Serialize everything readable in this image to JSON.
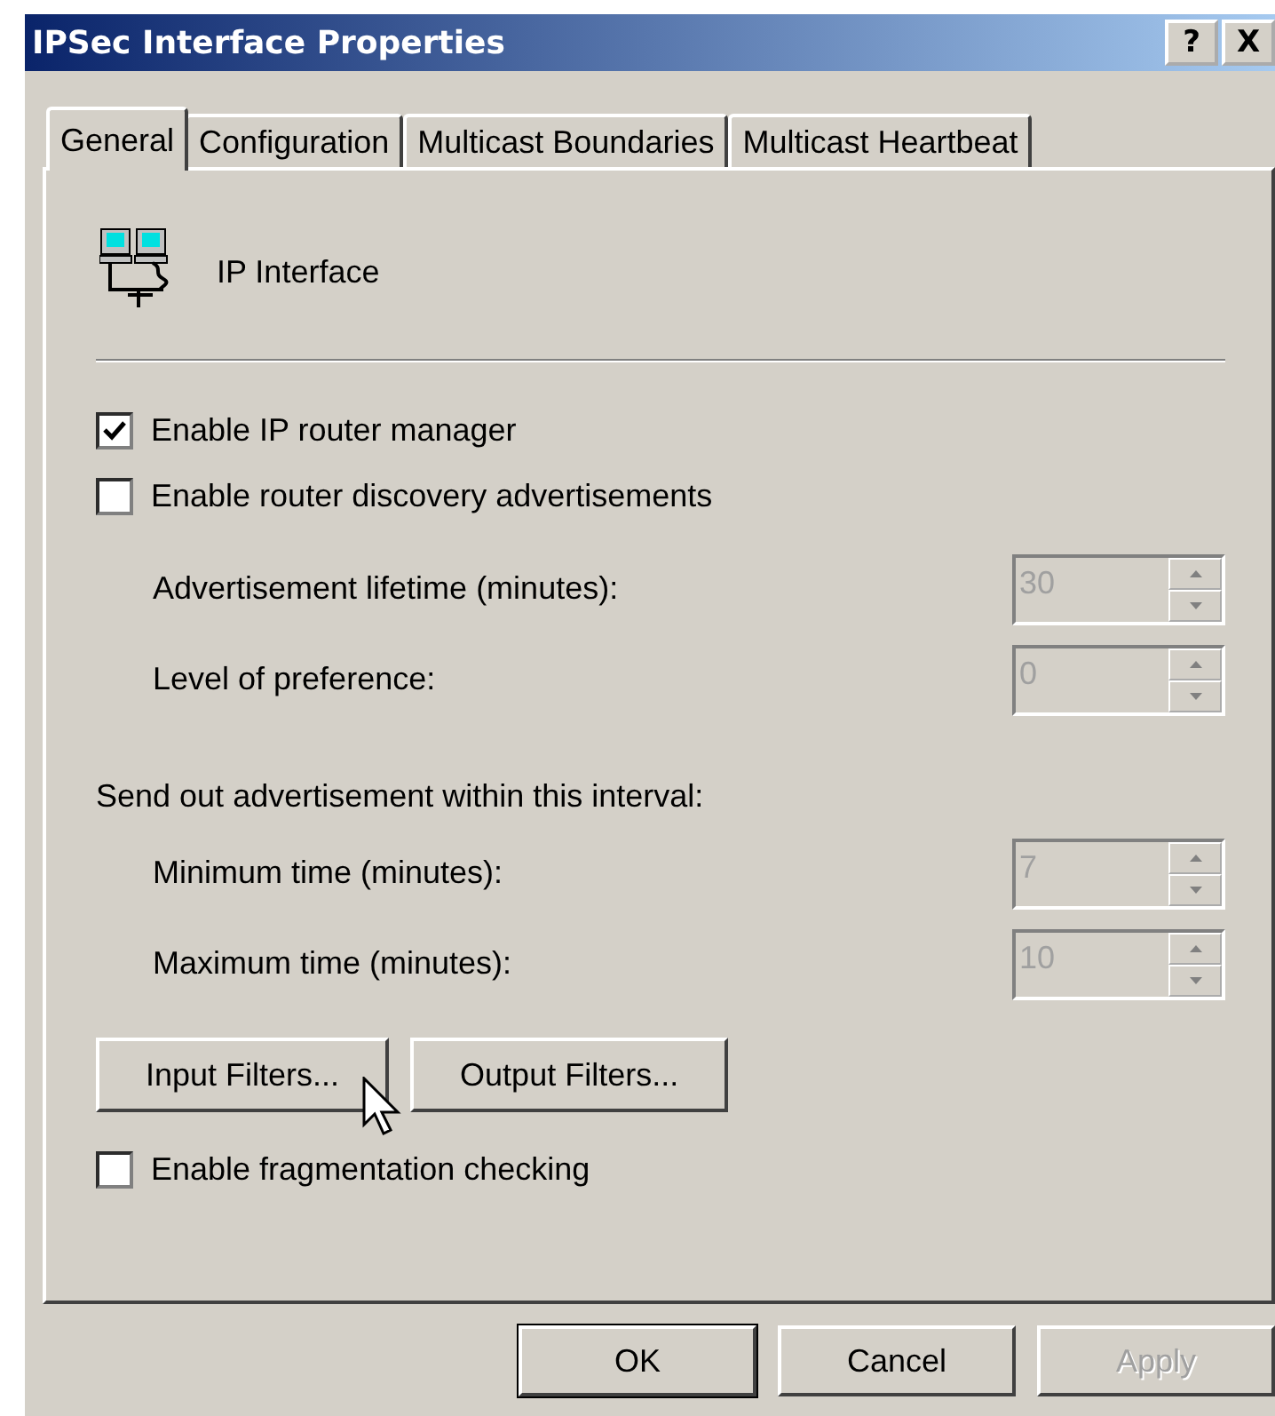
{
  "window": {
    "title": "IPSec Interface Properties",
    "title_buttons": [
      "?",
      "X"
    ]
  },
  "tabs": [
    {
      "label": "General",
      "selected": true
    },
    {
      "label": "Configuration",
      "selected": false
    },
    {
      "label": "Multicast Boundaries",
      "selected": false
    },
    {
      "label": "Multicast Heartbeat",
      "selected": false
    }
  ],
  "header": {
    "label": "IP Interface"
  },
  "options": [
    {
      "label": "Enable IP router manager",
      "checked": true
    },
    {
      "label": "Enable router discovery advertisements",
      "checked": false
    }
  ],
  "advertisement_fields": [
    {
      "label": "Advertisement lifetime (minutes):",
      "value": "30",
      "disabled": true
    },
    {
      "label": "Level of preference:",
      "value": "0",
      "disabled": true
    }
  ],
  "interval": {
    "label": "Send out advertisement within this interval:",
    "fields": [
      {
        "label": "Minimum time (minutes):",
        "value": "7",
        "disabled": true
      },
      {
        "label": "Maximum time (minutes):",
        "value": "10",
        "disabled": true
      }
    ]
  },
  "filter_buttons": [
    {
      "label": "Input Filters...",
      "hovered": true
    },
    {
      "label": "Output Filters...",
      "hovered": false
    }
  ],
  "fragmentation": {
    "label": "Enable fragmentation checking",
    "checked": false
  },
  "buttons": [
    {
      "label": "OK",
      "default": true,
      "disabled": false
    },
    {
      "label": "Cancel",
      "default": false,
      "disabled": false
    },
    {
      "label": "Apply",
      "default": false,
      "disabled": true
    }
  ]
}
